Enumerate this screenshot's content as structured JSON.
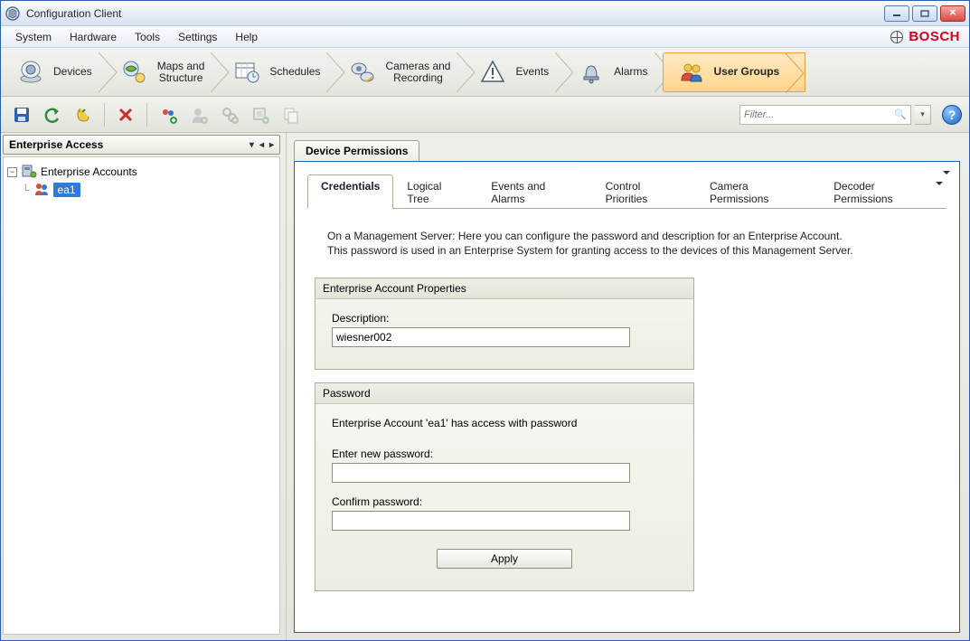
{
  "window": {
    "title": "Configuration Client"
  },
  "menu": {
    "items": [
      "System",
      "Hardware",
      "Tools",
      "Settings",
      "Help"
    ]
  },
  "brand": {
    "name": "BOSCH"
  },
  "nav": {
    "items": [
      {
        "label": "Devices",
        "icon": "devices"
      },
      {
        "label": "Maps and\nStructure",
        "icon": "maps"
      },
      {
        "label": "Schedules",
        "icon": "schedules"
      },
      {
        "label": "Cameras and\nRecording",
        "icon": "cameras"
      },
      {
        "label": "Events",
        "icon": "events"
      },
      {
        "label": "Alarms",
        "icon": "alarms"
      },
      {
        "label": "User Groups",
        "icon": "usergroups"
      }
    ],
    "selected": 6
  },
  "toolbar": {
    "filter_placeholder": "Filter...",
    "icons": [
      "save",
      "undo",
      "hand",
      "delete",
      "add-user",
      "add-person",
      "add-link",
      "add-enterprise",
      "copy"
    ]
  },
  "sidebar": {
    "header": "Enterprise Access",
    "tree": {
      "root": "Enterprise Accounts",
      "children": [
        {
          "label": "ea1",
          "selected": true
        }
      ]
    }
  },
  "main": {
    "panel_tab": "Device Permissions",
    "subtabs": [
      "Credentials",
      "Logical Tree",
      "Events and Alarms",
      "Control Priorities",
      "Camera Permissions",
      "Decoder Permissions"
    ],
    "subtab_active": 0,
    "info_line1": "On a Management Server: Here you can configure the password and description for an Enterprise Account.",
    "info_line2": "This password is used in an Enterprise System for granting access to the devices of this Management Server.",
    "group1": {
      "title": "Enterprise Account Properties",
      "desc_label": "Description:",
      "desc_value": "wiesner002"
    },
    "group2": {
      "title": "Password",
      "status": "Enterprise Account 'ea1' has access with password",
      "new_label": "Enter new password:",
      "confirm_label": "Confirm password:",
      "apply": "Apply"
    }
  }
}
